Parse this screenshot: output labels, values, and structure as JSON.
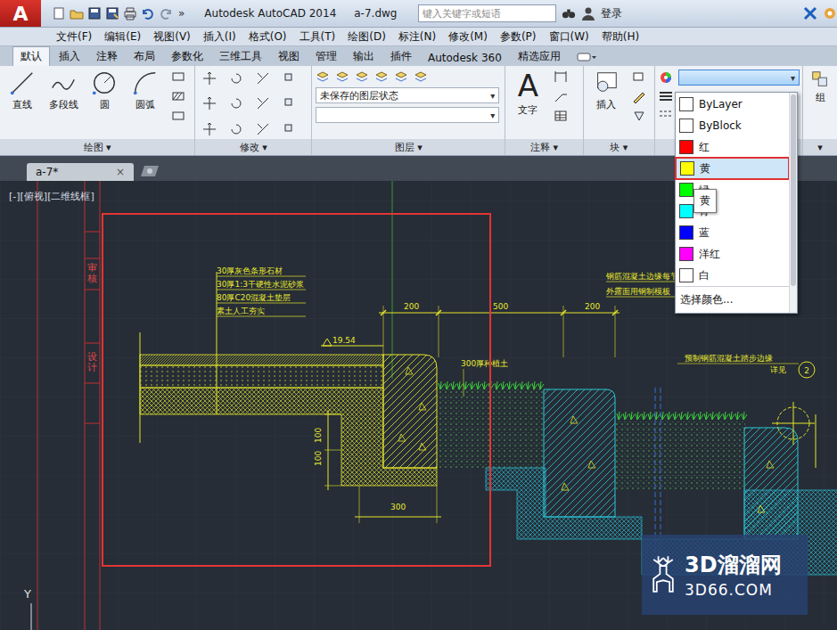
{
  "app": {
    "logo": "A",
    "more": "»",
    "title": "Autodesk AutoCAD 2014",
    "file": "a-7.dwg",
    "search_placeholder": "键入关键字或短语",
    "login": "登录"
  },
  "menu": [
    "文件(F)",
    "编辑(E)",
    "视图(V)",
    "插入(I)",
    "格式(O)",
    "工具(T)",
    "绘图(D)",
    "标注(N)",
    "修改(M)",
    "参数(P)",
    "窗口(W)",
    "帮助(H)"
  ],
  "ribbon_tabs": [
    {
      "label": "默认",
      "selected": true
    },
    {
      "label": "插入",
      "selected": false
    },
    {
      "label": "注释",
      "selected": false
    },
    {
      "label": "布局",
      "selected": false
    },
    {
      "label": "参数化",
      "selected": false
    },
    {
      "label": "三维工具",
      "selected": false
    },
    {
      "label": "视图",
      "selected": false
    },
    {
      "label": "管理",
      "selected": false
    },
    {
      "label": "输出",
      "selected": false
    },
    {
      "label": "插件",
      "selected": false
    },
    {
      "label": "Autodesk 360",
      "selected": false
    },
    {
      "label": "精选应用",
      "selected": false
    }
  ],
  "ribbon": {
    "panel_arrow": "▾",
    "draw": {
      "label": "绘图",
      "tools": [
        "直线",
        "多段线",
        "圆",
        "圆弧"
      ]
    },
    "modify": {
      "label": "修改"
    },
    "layers": {
      "label": "图层",
      "state": "未保存的图层状态"
    },
    "annotation": {
      "label": "注释",
      "tool": "文字",
      "glyph": "A"
    },
    "block": {
      "label": "块",
      "tool": "插入"
    },
    "group": {
      "label": "组"
    }
  },
  "color_dropdown": {
    "open": true,
    "items": [
      {
        "label": "ByLayer",
        "color": "#ffffff",
        "selected": false
      },
      {
        "label": "ByBlock",
        "color": "#ffffff",
        "selected": false
      },
      {
        "label": "红",
        "color": "#ff0000",
        "selected": false
      },
      {
        "label": "黄",
        "color": "#ffff00",
        "selected": true
      },
      {
        "label": "绿",
        "color": "#00ff00",
        "selected": false
      },
      {
        "label": "青",
        "color": "#00ffff",
        "selected": false
      },
      {
        "label": "蓝",
        "color": "#0000ff",
        "selected": false
      },
      {
        "label": "洋红",
        "color": "#ff00ff",
        "selected": false
      },
      {
        "label": "白",
        "color": "#ffffff",
        "selected": false
      }
    ],
    "footer": "选择颜色...",
    "tooltip": "黄"
  },
  "doc_tabs": [
    {
      "label": "a-7*",
      "selected": true,
      "close": "×"
    }
  ],
  "viewport_label": "[-][俯视][二维线框]",
  "title_block": [
    "审核",
    "设计"
  ],
  "axis": "Y",
  "drawing": {
    "annotations": [
      "30厚灰色条形石材",
      "30厚1:3干硬性水泥砂浆",
      "80厚C20混凝土垫层",
      "素土人工夯实",
      "19.54",
      "200",
      "500",
      "200",
      "300厚种植土",
      "钢筋混凝土边缘每节",
      "外露面用钢制模板",
      "预制钢筋混凝土踏步边缘",
      "详见",
      "2",
      "300",
      "100",
      "100"
    ]
  },
  "watermark": {
    "brand": "3D溜溜网",
    "url": "3D66.COM"
  }
}
